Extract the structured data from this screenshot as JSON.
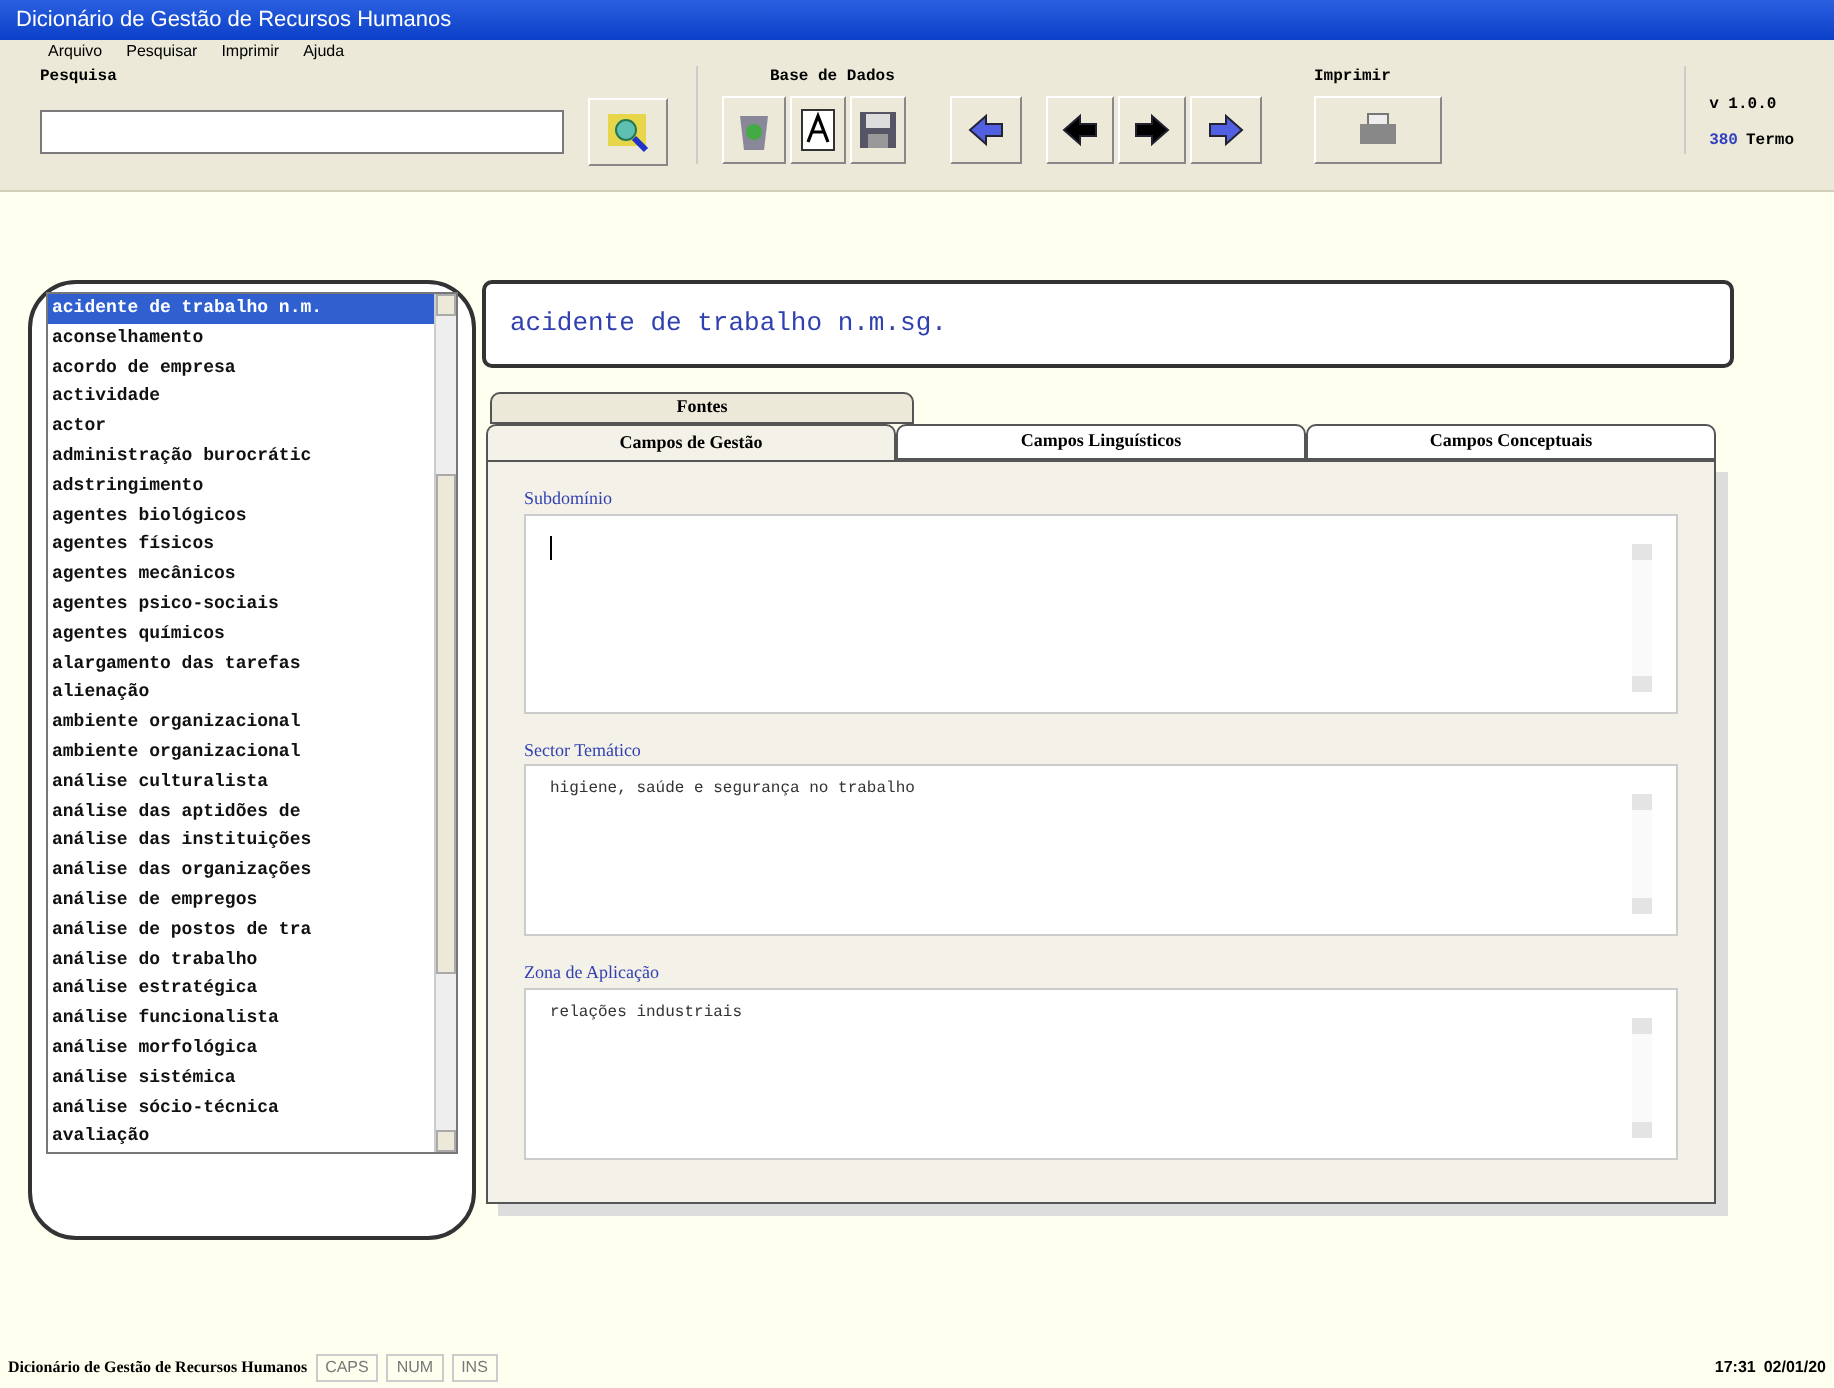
{
  "window": {
    "title": "Dicionário de Gestão de Recursos Humanos"
  },
  "menu": [
    "Arquivo",
    "Pesquisar",
    "Imprimir",
    "Ajuda"
  ],
  "toolbar": {
    "search_label": "Pesquisa",
    "database_label": "Base de Dados",
    "print_label": "Imprimir",
    "version": "v 1.0.0",
    "count": "380",
    "count_label": "Termo"
  },
  "terms": [
    {
      "label": "acidente de trabalho n.m.",
      "selected": true
    },
    {
      "label": "aconselhamento",
      "selected": false
    },
    {
      "label": "acordo de empresa",
      "selected": false
    },
    {
      "label": "actividade",
      "selected": false
    },
    {
      "label": "actor",
      "selected": false
    },
    {
      "label": "administração burocrátic",
      "selected": false
    },
    {
      "label": "adstringimento",
      "selected": false
    },
    {
      "label": "agentes biológicos",
      "selected": false
    },
    {
      "label": "agentes físicos",
      "selected": false
    },
    {
      "label": "agentes mecânicos",
      "selected": false
    },
    {
      "label": "agentes psico-sociais",
      "selected": false
    },
    {
      "label": "agentes químicos",
      "selected": false
    },
    {
      "label": "alargamento das tarefas",
      "selected": false
    },
    {
      "label": "alienação",
      "selected": false
    },
    {
      "label": "ambiente organizacional",
      "selected": false
    },
    {
      "label": "ambiente organizacional",
      "selected": false
    },
    {
      "label": "análise culturalista",
      "selected": false
    },
    {
      "label": "análise das aptidões de",
      "selected": false
    },
    {
      "label": "análise das instituições",
      "selected": false
    },
    {
      "label": "análise das organizações",
      "selected": false
    },
    {
      "label": "análise de empregos",
      "selected": false
    },
    {
      "label": "análise de postos de tra",
      "selected": false
    },
    {
      "label": "análise do trabalho",
      "selected": false
    },
    {
      "label": "análise estratégica",
      "selected": false
    },
    {
      "label": "análise funcionalista",
      "selected": false
    },
    {
      "label": "análise morfológica",
      "selected": false
    },
    {
      "label": "análise sistémica",
      "selected": false
    },
    {
      "label": "análise sócio-técnica",
      "selected": false
    },
    {
      "label": "avaliação",
      "selected": false
    }
  ],
  "entry": {
    "heading": "acidente de trabalho n.m.sg."
  },
  "back_tabs": [
    {
      "label": "Fontes",
      "selected": false
    }
  ],
  "tabs": [
    {
      "label": "Campos de Gestão",
      "selected": true
    },
    {
      "label": "Campos Linguísticos",
      "selected": false
    },
    {
      "label": "Campos Conceptuais",
      "selected": false
    }
  ],
  "fields": [
    {
      "label": "Subdomínio"
    },
    {
      "label": "Sector Temático",
      "value": "higiene, saúde e segurança no trabalho"
    },
    {
      "label": "Zona de Aplicação",
      "value": "relações industriais"
    }
  ],
  "status_bar": {
    "title": "Dicionário de Gestão de Recursos Humanos",
    "indicators": [
      "CAPS",
      "NUM",
      "INS"
    ],
    "time": "17:31",
    "date": "02/01/20"
  }
}
